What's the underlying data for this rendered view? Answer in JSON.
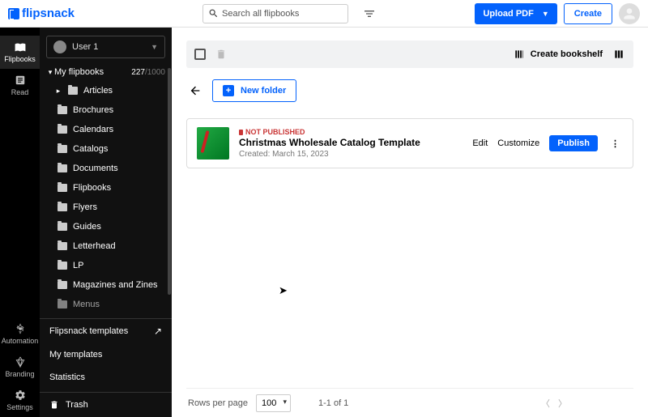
{
  "brand": "flipsnack",
  "search": {
    "placeholder": "Search all flipbooks"
  },
  "header": {
    "upload": "Upload PDF",
    "create": "Create"
  },
  "rail": {
    "flipbooks": "Flipbooks",
    "read": "Read",
    "automation": "Automation",
    "branding": "Branding",
    "settings": "Settings"
  },
  "sidebar": {
    "user": "User 1",
    "my_flipbooks": "My flipbooks",
    "count_current": "227",
    "count_total": "/1000",
    "folders": [
      "Articles",
      "Brochures",
      "Calendars",
      "Catalogs",
      "Documents",
      "Flipbooks",
      "Flyers",
      "Guides",
      "Letterhead",
      "LP",
      "Magazines and Zines",
      "Menus"
    ],
    "links": {
      "flipsnack_templates": "Flipsnack templates",
      "my_templates": "My templates",
      "statistics": "Statistics",
      "trash": "Trash"
    }
  },
  "toolbar": {
    "create_bookshelf": "Create bookshelf"
  },
  "actions": {
    "new_folder": "New folder"
  },
  "item": {
    "status": "NOT PUBLISHED",
    "title": "Christmas Wholesale Catalog Template",
    "created": "Created: March 15, 2023",
    "edit": "Edit",
    "customize": "Customize",
    "publish": "Publish"
  },
  "pager": {
    "rows_label": "Rows per page",
    "rows_value": "100",
    "range": "1-1 of 1"
  }
}
